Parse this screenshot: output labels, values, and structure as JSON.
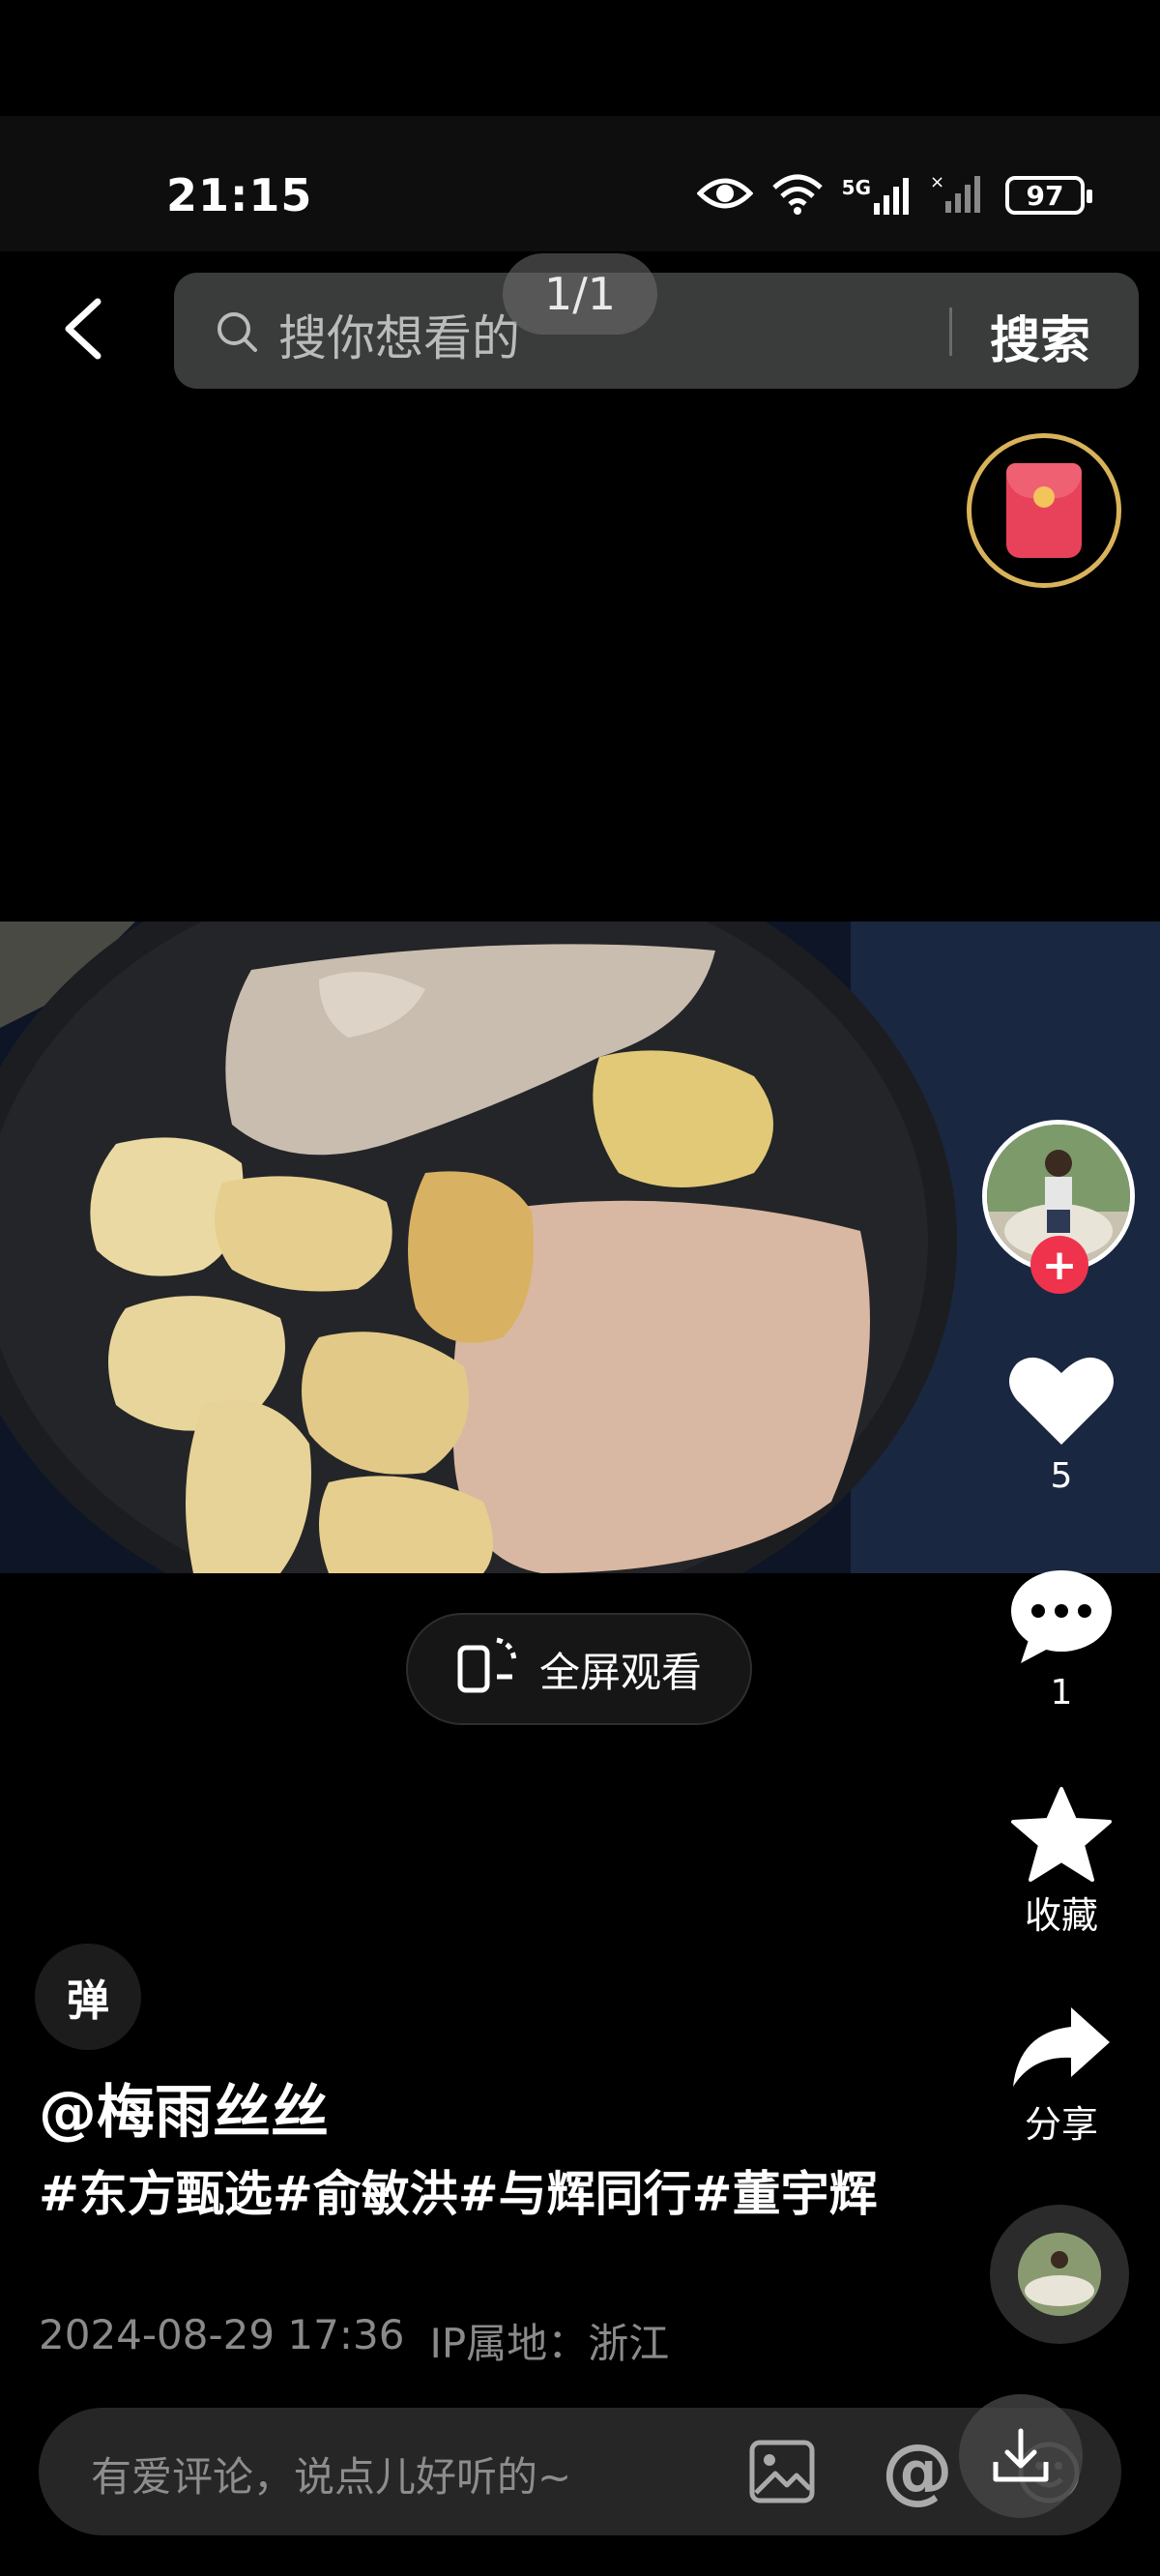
{
  "status_bar": {
    "time": "21:15",
    "network": "5G",
    "battery": "97"
  },
  "header": {
    "search_placeholder": "搜你想看的",
    "search_button": "搜索",
    "page_indicator": "1/1"
  },
  "video": {
    "fullscreen_label": "全屏观看"
  },
  "actions": {
    "likes": "5",
    "comments": "1",
    "favorite_label": "收藏",
    "share_label": "分享",
    "follow": "+"
  },
  "post": {
    "danmu_label": "弹",
    "author": "@梅雨丝丝",
    "caption": "#东方甄选#俞敏洪#与辉同行#董宇辉",
    "datetime": "2024-08-29 17:36",
    "ip_location": "IP属地：浙江"
  },
  "comment_bar": {
    "placeholder": "有爱评论，说点儿好听的~",
    "at_symbol": "@"
  },
  "colors": {
    "accent_red": "#f0334d",
    "gold_ring": "#d9b35a",
    "search_bg": "#3a3c3b"
  }
}
